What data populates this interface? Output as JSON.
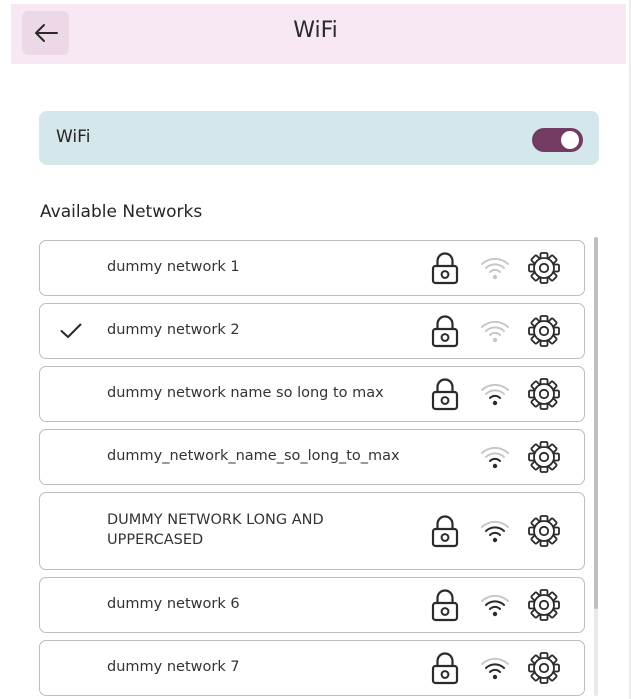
{
  "header": {
    "title": "WiFi",
    "back_icon": "arrow-left-icon"
  },
  "wifi_toggle": {
    "label": "WiFi",
    "state": "on",
    "color": "#743b62"
  },
  "available_networks": {
    "heading": "Available Networks",
    "networks": [
      {
        "name": "dummy network 1",
        "connected": false,
        "locked": true,
        "signal": "weak"
      },
      {
        "name": "dummy network 2",
        "connected": true,
        "locked": true,
        "signal": "weak"
      },
      {
        "name": "dummy network name so long to max",
        "connected": false,
        "locked": true,
        "signal": "medium"
      },
      {
        "name": "dummy_network_name_so_long_to_max",
        "connected": false,
        "locked": false,
        "signal": "medium"
      },
      {
        "name": "DUMMY NETWORK LONG AND UPPERCASED",
        "connected": false,
        "locked": true,
        "signal": "strong"
      },
      {
        "name": "dummy network 6",
        "connected": false,
        "locked": true,
        "signal": "strong"
      },
      {
        "name": "dummy network 7",
        "connected": false,
        "locked": true,
        "signal": "strong"
      }
    ]
  },
  "colors": {
    "header_background": "#f8e8f3",
    "back_button": "#ecd8e6",
    "wifi_row_background": "#d4e7ea",
    "toggle_on": "#743b62"
  },
  "icons": {
    "connected": "checkmark-icon",
    "locked": "lock-icon",
    "signal": "wifi-signal-icon",
    "settings": "gear-icon"
  }
}
